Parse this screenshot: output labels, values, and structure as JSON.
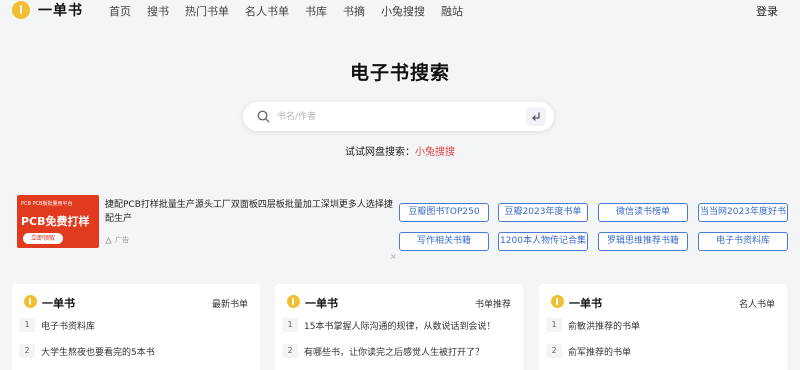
{
  "header": {
    "logo_text": "一单书",
    "nav": [
      "首页",
      "搜书",
      "热门书单",
      "名人书单",
      "书库",
      "书摘",
      "小兔搜搜",
      "融站"
    ],
    "login_label": "登录"
  },
  "hero": {
    "title": "电子书搜索",
    "search_placeholder": "书名/作者",
    "try_prefix": "试试网盘搜索：",
    "try_link": "小兔搜搜"
  },
  "ad": {
    "image_top": "PCB PCB板批量用平台",
    "image_big": "PCB免费打样",
    "image_button": "立即领取",
    "text": "捷配PCB打样批量生产源头工厂双面板四层板批量加工深圳更多人选择捷配生产",
    "tag": "广告",
    "close": "×"
  },
  "quick_links": [
    "豆瓣图书TOP250",
    "豆瓣2023年度书单",
    "微信读书榜单",
    "当当网2023年度好书",
    "写作相关书籍",
    "1200本人物传记合集",
    "罗辑思维推荐书籍",
    "电子书资料库"
  ],
  "cards": [
    {
      "logo_text": "一单书",
      "tag": "最新书单",
      "rows": [
        {
          "num": "1",
          "title": "电子书资料库"
        },
        {
          "num": "2",
          "title": "大学生熬夜也要看完的5本书"
        }
      ]
    },
    {
      "logo_text": "一单书",
      "tag": "书单推荐",
      "rows": [
        {
          "num": "1",
          "title": "15本书掌握人际沟通的规律，从数说话到会说！"
        },
        {
          "num": "2",
          "title": "有哪些书，让你读完之后感觉人生被打开了？"
        }
      ]
    },
    {
      "logo_text": "一单书",
      "tag": "名人书单",
      "rows": [
        {
          "num": "1",
          "title": "俞敏洪推荐的书单"
        },
        {
          "num": "2",
          "title": "俞军推荐的书单"
        }
      ]
    }
  ],
  "colors": {
    "brand_yellow": "#f2bf33",
    "link_blue": "#3a6ac8",
    "accent_red": "#e04040",
    "page_background": "#f4f5f7"
  }
}
